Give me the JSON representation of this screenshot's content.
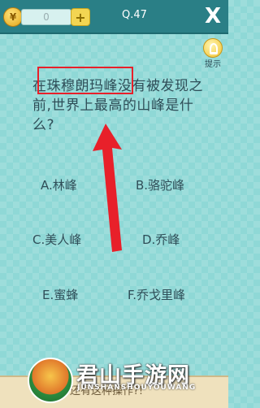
{
  "header": {
    "coin_symbol": "¥",
    "coin_count": "0",
    "add_label": "+",
    "level": "Q.47",
    "close_label": "X"
  },
  "hint": {
    "label": "提示"
  },
  "question": {
    "text": "在珠穆朗玛峰没有被发现之前,世界上最高的山峰是什么?"
  },
  "options": [
    {
      "label": "A.林峰"
    },
    {
      "label": "B.骆驼峰"
    },
    {
      "label": "C.美人峰"
    },
    {
      "label": "D.乔峰"
    },
    {
      "label": "E.蜜蜂"
    },
    {
      "label": "F.乔戈里峰"
    }
  ],
  "footer": {
    "text": "还有这种操作?!"
  },
  "watermark": {
    "title": "君山手游网",
    "subtitle": "JUNSHANSHOUYOUWANG"
  },
  "colors": {
    "background": "#8fd8d6",
    "topbar": "#2a7f86",
    "annotation": "#e8202a"
  }
}
